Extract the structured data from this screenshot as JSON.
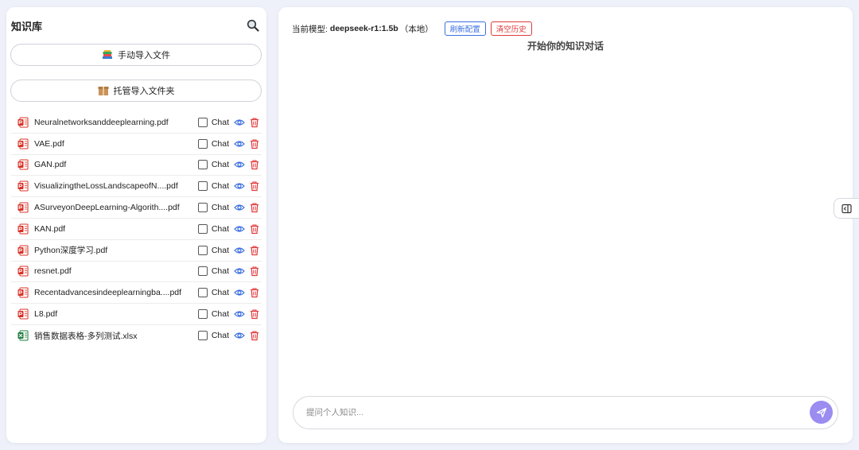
{
  "sidebar": {
    "title": "知识库",
    "manual_import_label": "手动导入文件",
    "folder_import_label": "托管导入文件夹",
    "chat_label": "Chat",
    "files": [
      {
        "name": "Neuralnetworksanddeeplearning.pdf",
        "type": "pdf"
      },
      {
        "name": "VAE.pdf",
        "type": "pdf"
      },
      {
        "name": "GAN.pdf",
        "type": "pdf"
      },
      {
        "name": "VisualizingtheLossLandscapeofN....pdf",
        "type": "pdf"
      },
      {
        "name": "ASurveyonDeepLearning-Algorith....pdf",
        "type": "pdf"
      },
      {
        "name": "KAN.pdf",
        "type": "pdf"
      },
      {
        "name": "Python深度学习.pdf",
        "type": "pdf"
      },
      {
        "name": "resnet.pdf",
        "type": "pdf"
      },
      {
        "name": "Recentadvancesindeeplearningba....pdf",
        "type": "pdf"
      },
      {
        "name": "L8.pdf",
        "type": "pdf"
      },
      {
        "name": "销售数据表格-多列测试.xlsx",
        "type": "xlsx"
      }
    ]
  },
  "main": {
    "model_prefix": "当前模型:",
    "model_name": "deepseek-r1:1.5b",
    "model_suffix": "（本地）",
    "refresh_label": "刷新配置",
    "clear_label": "清空历史",
    "chat_title": "开始你的知识对话",
    "input_placeholder": "提问个人知识...",
    "input_value": ""
  },
  "icons": {
    "search": "search-icon",
    "manual_import": "books-icon",
    "folder_import": "box-icon",
    "pdf": "pdf-file-icon",
    "xlsx": "excel-file-icon",
    "view": "eye-icon",
    "delete": "trash-icon",
    "send": "send-icon",
    "panel": "panel-toggle-icon"
  },
  "colors": {
    "background": "#eef0fa",
    "accent_blue": "#3b6fe0",
    "danger_red": "#e0393b",
    "send_purple": "#9a8cf0",
    "pdf_red": "#d93025",
    "excel_green": "#1e7a3c"
  }
}
